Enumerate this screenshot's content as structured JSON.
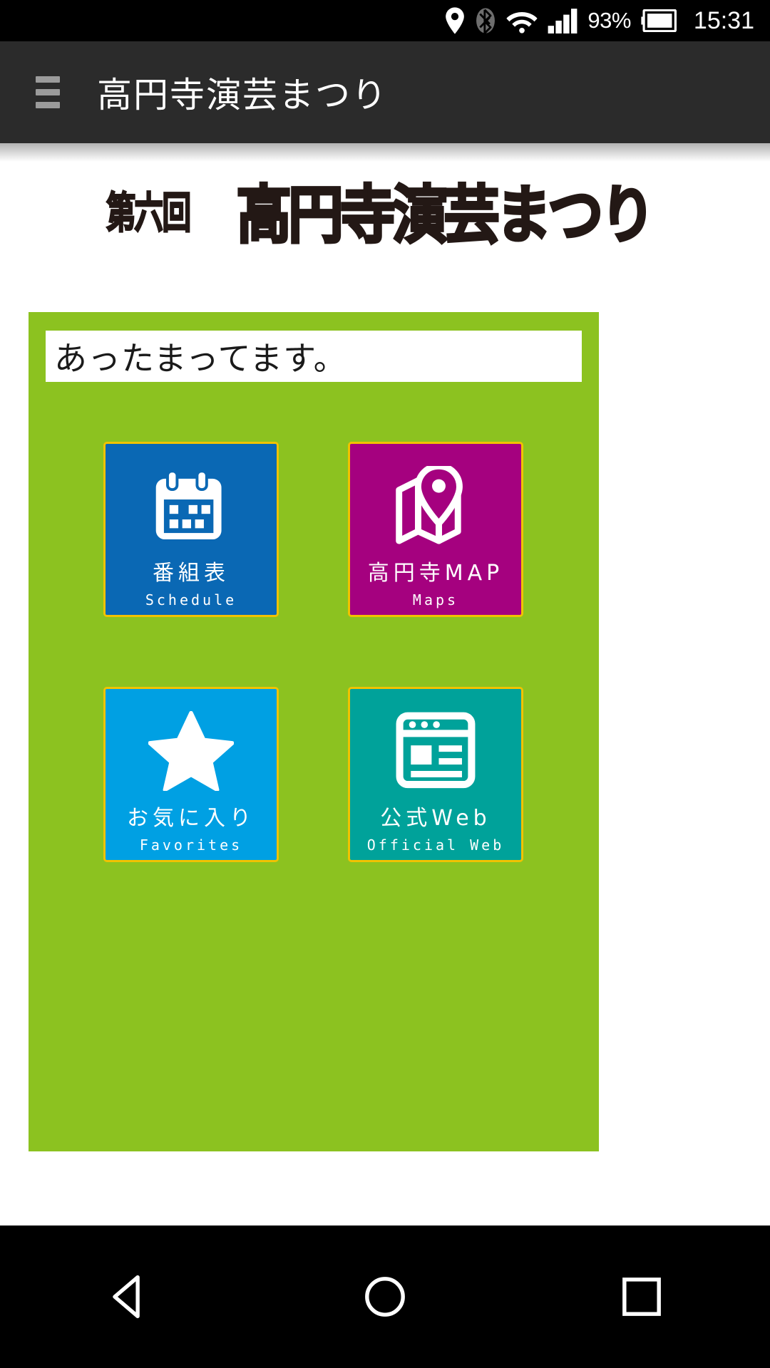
{
  "status_bar": {
    "icons": [
      "location-pin-icon",
      "bluetooth-icon",
      "wifi-icon",
      "signal-bars-icon",
      "battery-icon"
    ],
    "battery_percent": "93%",
    "time": "15:31"
  },
  "app_bar": {
    "menu_icon": "hamburger-menu-icon",
    "title": "高円寺演芸まつり"
  },
  "logo": {
    "prefix": "第六回",
    "main": "高円寺演芸まつり"
  },
  "panel": {
    "background_color": "#8cc220",
    "message": "あったまってます。"
  },
  "tiles": [
    {
      "jp": "番組表",
      "en": "Schedule",
      "icon": "calendar-icon",
      "color": "#0a68b4",
      "border_color": "#f2c200"
    },
    {
      "jp": "高円寺MAP",
      "en": "Maps",
      "icon": "map-pin-icon",
      "color": "#a5017f",
      "border_color": "#f2c200"
    },
    {
      "jp": "お気に入り",
      "en": "Favorites",
      "icon": "star-icon",
      "color": "#00a0e3",
      "border_color": "#f2c200"
    },
    {
      "jp": "公式Web",
      "en": "Official Web",
      "icon": "browser-window-icon",
      "color": "#00a29a",
      "border_color": "#f2c200"
    }
  ],
  "nav_bar": {
    "back": "back-triangle-icon",
    "home": "home-circle-icon",
    "recents": "recents-square-icon"
  }
}
